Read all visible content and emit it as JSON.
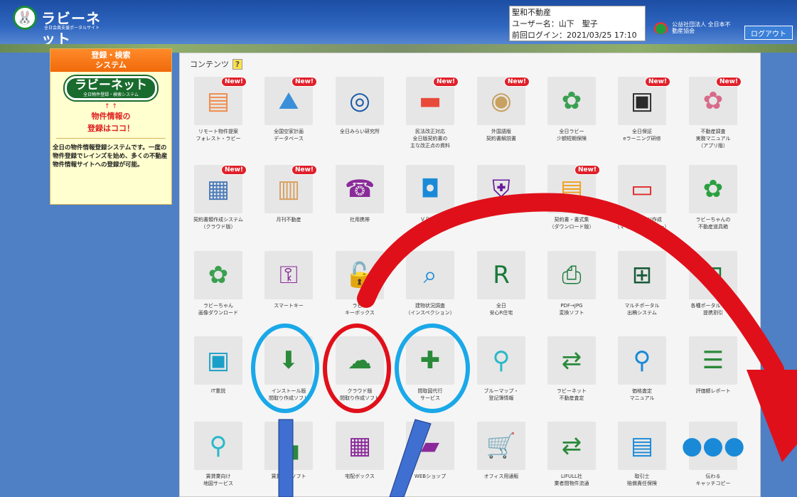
{
  "header": {
    "logo_text": "ラビーネット",
    "logo_sub": "全日会員支援ポータルサイト",
    "user_company": "聖和不動産",
    "user_name": "ユーザー名：山下　聖子",
    "last_login": "前回ログイン：2021/03/25 17:10",
    "association_name": "公益社団法人 全日本不動産協会",
    "logout_label": "ログアウト"
  },
  "sidebar": {
    "title_line1": "登録・検索",
    "title_line2": "システム",
    "system_logo": "ラビーネット",
    "system_logo_sub": "全日物件登録・検索システム",
    "arrows": "↑ ↑",
    "cta_line1": "物件情報の",
    "cta_line2": "登録はココ！",
    "description": "全日の物件情報登録システムです。一度の物件登録でレインズを始め、多くの不動産物件情報サイトへの登録が可能。"
  },
  "content": {
    "title": "コンテンツ",
    "help_label": "?",
    "new_label": "New!",
    "items": [
      {
        "label": "リモート物件提案\nフォレスト・ラビー",
        "icon": "browser-icon",
        "color": "#f08a4a",
        "glyph": "▤",
        "new": true
      },
      {
        "label": "全国空家計画\nデータベース",
        "icon": "japan-map-icon",
        "color": "#3a8fd8",
        "glyph": "⛰",
        "new": true
      },
      {
        "label": "全日みらい研究所",
        "icon": "research-seal-icon",
        "color": "#1a5aa8",
        "glyph": "◎",
        "new": false
      },
      {
        "label": "民法改正対応\n全日版契約書の\n主な改正点の資料",
        "icon": "document-icon",
        "color": "#e84a3a",
        "glyph": "▬",
        "new": true
      },
      {
        "label": "外国語版\n契約書解説書",
        "icon": "globe-icon",
        "color": "#c8a060",
        "glyph": "◉",
        "new": true
      },
      {
        "label": "全日ラビー\n少額短期保険",
        "icon": "insurance-mascot-icon",
        "color": "#3aa050",
        "glyph": "✿",
        "new": false
      },
      {
        "label": "全日保証\neラーニング研修",
        "icon": "monitor-icon",
        "color": "#2a2a2a",
        "glyph": "▣",
        "new": true
      },
      {
        "label": "不動産調査\n実務マニュアル\n（アプリ版）",
        "icon": "manual-mascot-icon",
        "color": "#d86a8a",
        "glyph": "✿",
        "new": true
      },
      {
        "label": "契約書類作成システム\n（クラウド版）",
        "icon": "forms-icon",
        "color": "#4a7ab8",
        "glyph": "▦",
        "new": true
      },
      {
        "label": "月刊不動産",
        "icon": "magazine-icon",
        "color": "#d8a060",
        "glyph": "▥",
        "new": true
      },
      {
        "label": "社用携帯",
        "icon": "phone-icon",
        "color": "#8a2a9a",
        "glyph": "☎",
        "new": false
      },
      {
        "label": "ＶＲ内見",
        "icon": "vr-icon",
        "color": "#1a8ad8",
        "glyph": "◘",
        "new": false
      },
      {
        "label": "",
        "icon": "shield-icon",
        "color": "#6a1a9a",
        "glyph": "⛨",
        "new": false
      },
      {
        "label": "契約書・書式集\n（ダウンロード版）",
        "icon": "file-download-icon",
        "color": "#f0a020",
        "glyph": "▤",
        "new": true
      },
      {
        "label": "ホームページ作成\n（マイページメイカー）",
        "icon": "laptop-icon",
        "color": "#e02a2a",
        "glyph": "▭",
        "new": false
      },
      {
        "label": "ラビーちゃんの\n不動産道具箱",
        "icon": "toolbox-mascot-icon",
        "color": "#2aa040",
        "glyph": "✿",
        "new": false
      },
      {
        "label": "ラビーちゃん\n画像ダウンロード",
        "icon": "mascot-icon",
        "color": "#3aa050",
        "glyph": "✿",
        "new": false
      },
      {
        "label": "スマートキー",
        "icon": "smart-key-icon",
        "color": "#8a2a9a",
        "glyph": "⚿",
        "new": false
      },
      {
        "label": "ラビー\nキーボックス",
        "icon": "keybox-icon",
        "color": "#c83a2a",
        "glyph": "🔓",
        "new": false
      },
      {
        "label": "建物状況調査\n（インスペクション）",
        "icon": "inspection-icon",
        "color": "#1a8ad8",
        "glyph": "⌕",
        "new": false
      },
      {
        "label": "全日\n安心R住宅",
        "icon": "r-house-icon",
        "color": "#1a7a3a",
        "glyph": "R",
        "new": false
      },
      {
        "label": "PDF→JPG\n変換ソフト",
        "icon": "pdf-icon",
        "color": "#1a7a3a",
        "glyph": "⎙",
        "new": false
      },
      {
        "label": "マルチポータル\n出稿システム",
        "icon": "network-icon",
        "color": "#1a5a3a",
        "glyph": "⊞",
        "new": false
      },
      {
        "label": "各種ポータルサイト\n提携割引",
        "icon": "frame-icon",
        "color": "#1a7a3a",
        "glyph": "⊡",
        "new": false
      },
      {
        "label": "IT重説",
        "icon": "id-card-icon",
        "color": "#1aa0c8",
        "glyph": "▣",
        "new": false
      },
      {
        "label": "インストール版\n間取り作成ソフト",
        "icon": "download-icon",
        "color": "#2a8a3a",
        "glyph": "⬇",
        "new": false
      },
      {
        "label": "クラウド版\n間取り作成ソフト",
        "icon": "cloud-download-icon",
        "color": "#2a8a3a",
        "glyph": "☁",
        "new": false
      },
      {
        "label": "間取図代行\nサービス",
        "icon": "add-user-icon",
        "color": "#2a8a3a",
        "glyph": "✚",
        "new": false
      },
      {
        "label": "ブルーマップ・\n登記簿情報",
        "icon": "map-pin-icon",
        "color": "#2ab8c8",
        "glyph": "⚲",
        "new": false
      },
      {
        "label": "ラビーネット\n不動産査定",
        "icon": "shuffle-icon",
        "color": "#2a8a3a",
        "glyph": "⇄",
        "new": false
      },
      {
        "label": "価格査定\nマニュアル",
        "icon": "search-icon",
        "color": "#1a8ad8",
        "glyph": "⚲",
        "new": false
      },
      {
        "label": "評価額レポート",
        "icon": "list-icon",
        "color": "#2a8a3a",
        "glyph": "☰",
        "new": false
      },
      {
        "label": "賃貸業向け\n地図サービス",
        "icon": "pin-icon",
        "color": "#2ab8c8",
        "glyph": "⚲",
        "new": false
      },
      {
        "label": "賃貸管理ソフト",
        "icon": "building-icon",
        "color": "#2a8a3a",
        "glyph": "▙",
        "new": false
      },
      {
        "label": "宅配ボックス",
        "icon": "delivery-box-icon",
        "color": "#8a2a9a",
        "glyph": "▦",
        "new": false
      },
      {
        "label": "WEBショップ",
        "icon": "shopping-bag-icon",
        "color": "#8a2a9a",
        "glyph": "▰",
        "new": false
      },
      {
        "label": "オフィス用通販",
        "icon": "cart-icon",
        "color": "#8a2a9a",
        "glyph": "🛒",
        "new": false
      },
      {
        "label": "LIFULL社\n業者間物件流通",
        "icon": "exchange-icon",
        "color": "#2a8a3a",
        "glyph": "⇄",
        "new": false
      },
      {
        "label": "取引士\n賠償責任保険",
        "icon": "document-icon",
        "color": "#1a8ad8",
        "glyph": "▤",
        "new": false
      },
      {
        "label": "伝わる\nキャッチコピー",
        "icon": "chat-bubble-icon",
        "color": "#1a8ad8",
        "glyph": "●●●",
        "new": false
      }
    ]
  },
  "colors": {
    "header": "#1c4ea3",
    "background": "#4f7fc4",
    "annotation_red": "#e0101a",
    "annotation_blue": "#1aa8e8"
  }
}
